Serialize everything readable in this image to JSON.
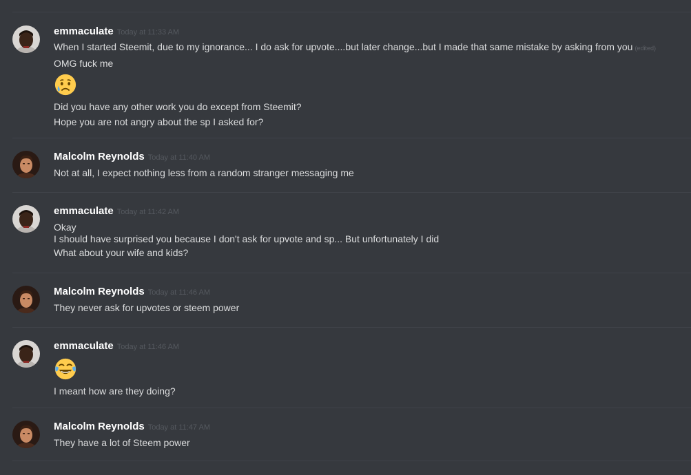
{
  "messages": [
    {
      "author": "emmaculate",
      "timestamp": "Today at 11:33 AM",
      "line1": "When I started Steemit, due to my ignorance... I do ask for upvote....but later change...but I made that same mistake by asking from you",
      "edited": "(edited)",
      "line2": "OMG fuck me",
      "emoji": "crying-face-emoji",
      "line3": "Did you have any other work you do except from Steemit?",
      "line4": "Hope you are not angry about the sp I asked for?"
    },
    {
      "author": "Malcolm Reynolds",
      "timestamp": "Today at 11:40 AM",
      "line1": "Not at all, I expect nothing less from a random stranger messaging me"
    },
    {
      "author": "emmaculate",
      "timestamp": "Today at 11:42 AM",
      "line1": "Okay",
      "line2": "I should have surprised you because I don't ask for upvote and sp... But unfortunately I did",
      "line3": "What about your wife and kids?"
    },
    {
      "author": "Malcolm Reynolds",
      "timestamp": "Today at 11:46 AM",
      "line1": "They never ask for upvotes or steem power"
    },
    {
      "author": "emmaculate",
      "timestamp": "Today at 11:46 AM",
      "emoji": "tears-of-joy-emoji",
      "line1": "I meant how are they doing?"
    },
    {
      "author": "Malcolm Reynolds",
      "timestamp": "Today at 11:47 AM",
      "line1": "They have a lot of Steem power"
    }
  ],
  "colors": {
    "background": "#36393e",
    "username": "#ffffff",
    "message_text": "#dcddde",
    "timestamp": "#55595f",
    "divider": "#40434a"
  }
}
